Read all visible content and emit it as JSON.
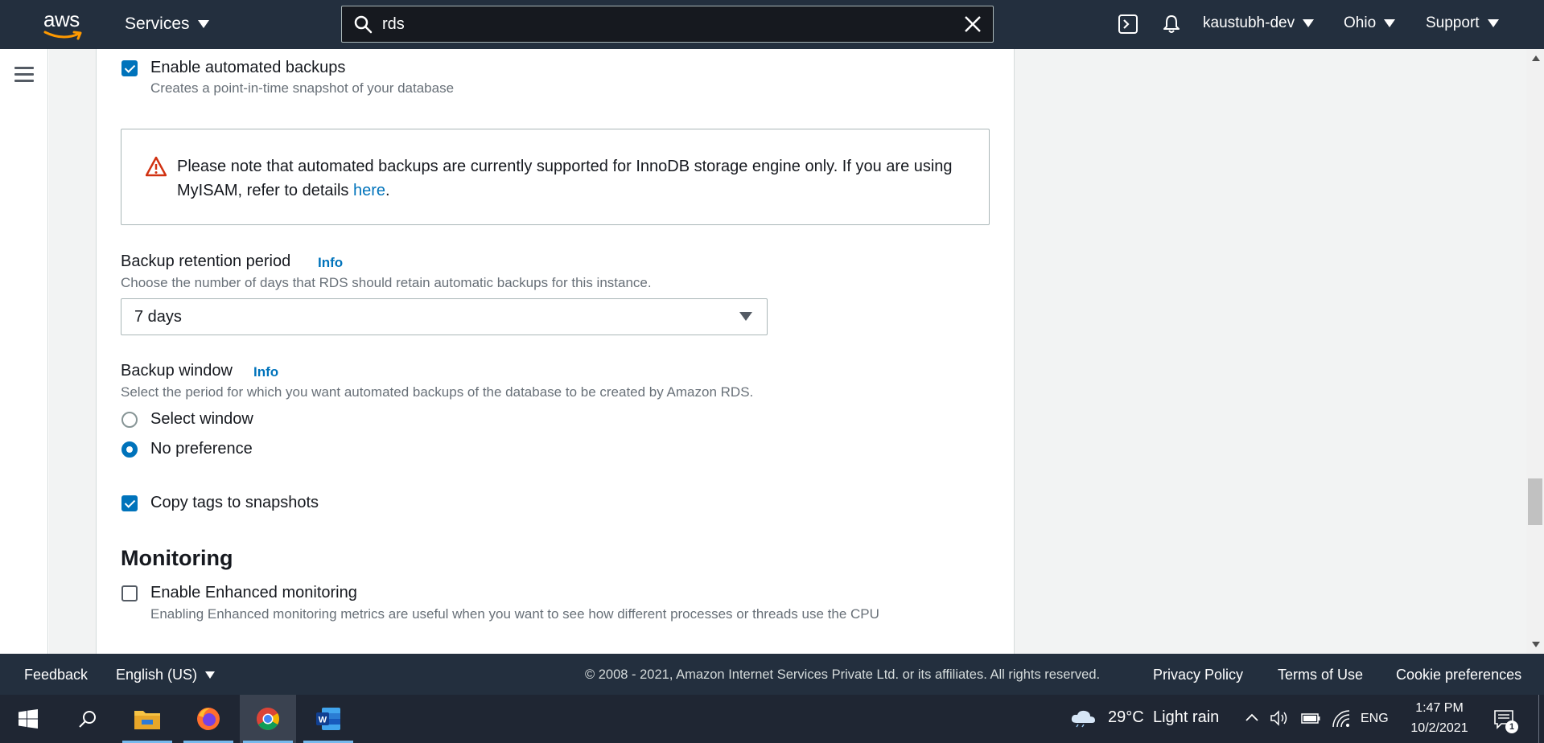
{
  "topnav": {
    "logo_text": "aws",
    "services_label": "Services",
    "search_value": "rds",
    "account_label": "kaustubh-dev",
    "region_label": "Ohio",
    "support_label": "Support"
  },
  "backup": {
    "enable_backups_label": "Enable automated backups",
    "enable_backups_desc": "Creates a point-in-time snapshot of your database",
    "enable_backups_checked": true,
    "alert_text": "Please note that automated backups are currently supported for InnoDB storage engine only. If you are using MyISAM, refer to details ",
    "alert_link": "here",
    "alert_tail": ".",
    "retention_label": "Backup retention period",
    "retention_info": "Info",
    "retention_desc": "Choose the number of days that RDS should retain automatic backups for this instance.",
    "retention_value": "7 days",
    "window_label": "Backup window",
    "window_info": "Info",
    "window_desc": "Select the period for which you want automated backups of the database to be created by Amazon RDS.",
    "window_options": [
      "Select window",
      "No preference"
    ],
    "window_selected": "No preference",
    "copy_tags_label": "Copy tags to snapshots",
    "copy_tags_checked": true
  },
  "monitoring": {
    "heading": "Monitoring",
    "enhanced_label": "Enable Enhanced monitoring",
    "enhanced_desc": "Enabling Enhanced monitoring metrics are useful when you want to see how different processes or threads use the CPU",
    "enhanced_checked": false
  },
  "footer": {
    "feedback": "Feedback",
    "language": "English (US)",
    "copyright": "© 2008 - 2021, Amazon Internet Services Private Ltd. or its affiliates. All rights reserved.",
    "privacy": "Privacy Policy",
    "terms": "Terms of Use",
    "cookies": "Cookie preferences"
  },
  "taskbar": {
    "weather_temp": "29°C",
    "weather_desc": "Light rain",
    "language": "ENG",
    "time": "1:47 PM",
    "date": "10/2/2021",
    "notification_count": "1"
  },
  "colors": {
    "nav_bg": "#232f3e",
    "accent": "#0073bb",
    "warning": "#d13212"
  }
}
